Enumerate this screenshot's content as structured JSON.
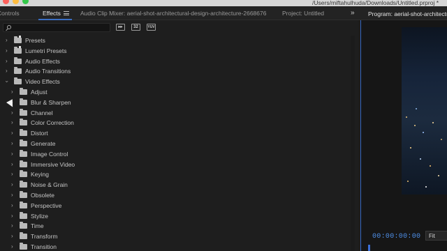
{
  "window": {
    "path": "/Users/miftahulhuda/Downloads/Untitled.prproj *"
  },
  "tabs": {
    "controls": "Controls",
    "effects": "Effects",
    "audio_clip_mixer": "Audio Clip Mixer: aerial-shot-architectural-design-architecture-2668676",
    "project": "Project: Untitled",
    "overflow": "»"
  },
  "toolbar": {
    "accelerated_label": "",
    "bit_label": "32",
    "yuv_label": "YUV",
    "search_value": ""
  },
  "tree": {
    "top": [
      {
        "label": "Presets",
        "icon": "folder-star-icon",
        "expanded": false
      },
      {
        "label": "Lumetri Presets",
        "icon": "folder-star-icon",
        "expanded": false
      },
      {
        "label": "Audio Effects",
        "icon": "folder-icon",
        "expanded": false
      },
      {
        "label": "Audio Transitions",
        "icon": "folder-icon",
        "expanded": false
      },
      {
        "label": "Video Effects",
        "icon": "folder-icon",
        "expanded": true
      }
    ],
    "video_effects": [
      "Adjust",
      "Blur & Sharpen",
      "Channel",
      "Color Correction",
      "Distort",
      "Generate",
      "Image Control",
      "Immersive Video",
      "Keying",
      "Noise & Grain",
      "Obsolete",
      "Perspective",
      "Stylize",
      "Time",
      "Transform",
      "Transition"
    ]
  },
  "program": {
    "title": "Program: aerial-shot-architecturi",
    "timecode": "00:00:00:00",
    "fit": "Fit"
  },
  "colors": {
    "accent": "#3b6fc4",
    "timecode": "#4e8fe8",
    "panel_bg": "#1e1e1e"
  }
}
